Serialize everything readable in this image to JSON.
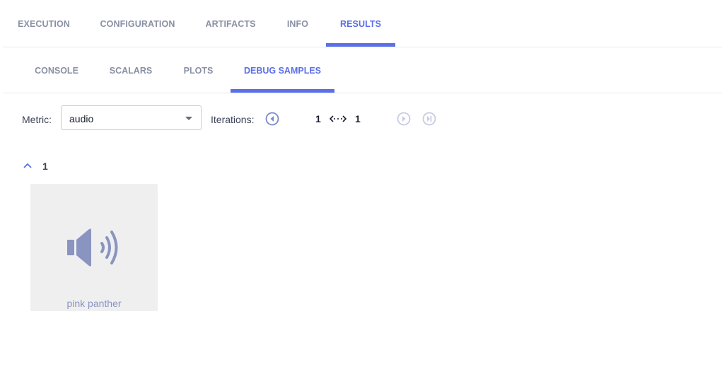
{
  "tabs": [
    {
      "label": "EXECUTION",
      "active": false
    },
    {
      "label": "CONFIGURATION",
      "active": false
    },
    {
      "label": "ARTIFACTS",
      "active": false
    },
    {
      "label": "INFO",
      "active": false
    },
    {
      "label": "RESULTS",
      "active": true
    }
  ],
  "subtabs": [
    {
      "label": "CONSOLE",
      "active": false
    },
    {
      "label": "SCALARS",
      "active": false
    },
    {
      "label": "PLOTS",
      "active": false
    },
    {
      "label": "DEBUG SAMPLES",
      "active": true
    }
  ],
  "toolbar": {
    "metric_label": "Metric:",
    "metric_value": "audio",
    "iterations_label": "Iterations:",
    "iter_from": "1",
    "iter_to": "1"
  },
  "group": {
    "title": "1"
  },
  "samples": [
    {
      "caption": "pink panther",
      "icon": "speaker-icon"
    }
  ],
  "colors": {
    "accent": "#5a6fe8",
    "muted": "#8a90a4",
    "card_bg": "#efefef",
    "icon": "#8a94c0"
  }
}
